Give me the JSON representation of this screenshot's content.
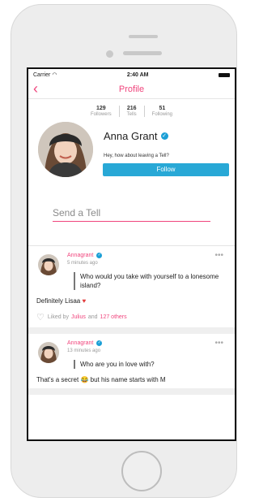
{
  "status": {
    "carrier": "Carrier",
    "time": "2:40 AM"
  },
  "nav": {
    "title": "Profile",
    "back_glyph": "‹"
  },
  "stats": [
    {
      "value": "129",
      "label": "Followers"
    },
    {
      "value": "216",
      "label": "Tells"
    },
    {
      "value": "51",
      "label": "Following"
    }
  ],
  "profile": {
    "name": "Anna Grant",
    "tagline": "Hey, how about leaving a Tell?",
    "follow_label": "Follow"
  },
  "compose": {
    "placeholder": "Send a Tell"
  },
  "posts": [
    {
      "user": "Annagrant",
      "time_ago": "5 minutes ago",
      "question": "Who would you take with yourself to a lonesome island?",
      "answer": "Definitely Lisaa",
      "likes_prefix": "Liked by",
      "likes_user": "Julius",
      "likes_mid": "and",
      "likes_others": "127 others"
    },
    {
      "user": "Annagrant",
      "time_ago": "13 minutes ago",
      "question": "Who are you in love with?",
      "answer": "That's a secret 😂 but his name starts with M"
    }
  ],
  "colors": {
    "accent": "#f0457d",
    "follow": "#28a8d6",
    "verified": "#1b9fd6"
  },
  "icons": [
    "back-chevron-icon",
    "verified-icon",
    "more-icon",
    "heart-icon",
    "like-heart-outline-icon",
    "wifi-icon",
    "battery-icon"
  ]
}
